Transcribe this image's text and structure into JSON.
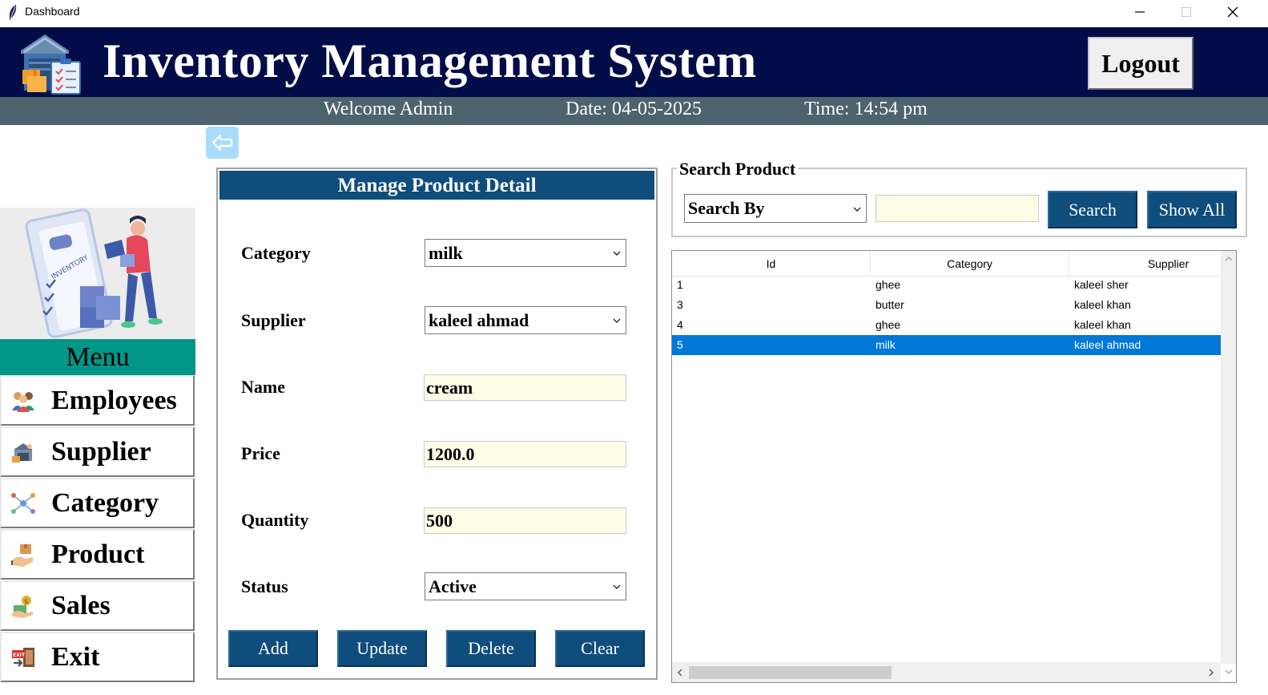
{
  "window": {
    "title": "Dashboard",
    "controls": [
      "minimize-icon",
      "maximize-icon",
      "close-icon"
    ]
  },
  "header": {
    "title": "Inventory Management System",
    "logout_label": "Logout",
    "colors": {
      "background": "#010c48",
      "subbar": "#4d636d"
    }
  },
  "subheader": {
    "welcome": "Welcome Admin",
    "date": "Date: 04-05-2025",
    "time": "Time: 14:54 pm"
  },
  "menu": {
    "heading": "Menu",
    "items": [
      {
        "label": "Employees",
        "icon": "employees-icon"
      },
      {
        "label": "Supplier",
        "icon": "supplier-icon"
      },
      {
        "label": "Category",
        "icon": "category-icon"
      },
      {
        "label": "Product",
        "icon": "product-icon"
      },
      {
        "label": "Sales",
        "icon": "sales-icon"
      },
      {
        "label": "Exit",
        "icon": "exit-icon"
      }
    ]
  },
  "manage": {
    "title": "Manage Product Detail",
    "fields": {
      "category": {
        "label": "Category",
        "value": "milk"
      },
      "supplier": {
        "label": "Supplier",
        "value": "kaleel ahmad"
      },
      "name": {
        "label": "Name",
        "value": "cream"
      },
      "price": {
        "label": "Price",
        "value": "1200.0"
      },
      "quantity": {
        "label": "Quantity",
        "value": "500"
      },
      "status": {
        "label": "Status",
        "value": "Active"
      }
    },
    "buttons": {
      "add": "Add",
      "update": "Update",
      "delete": "Delete",
      "clear": "Clear"
    },
    "accent": "#0f4d7d"
  },
  "search": {
    "legend": "Search Product",
    "search_by": "Search By",
    "query": "",
    "search_label": "Search",
    "show_all_label": "Show All"
  },
  "table": {
    "columns": [
      "Id",
      "Category",
      "Supplier"
    ],
    "rows": [
      {
        "id": "1",
        "category": "ghee",
        "supplier": "kaleel sher",
        "selected": false
      },
      {
        "id": "3",
        "category": "butter",
        "supplier": "kaleel khan",
        "selected": false
      },
      {
        "id": "4",
        "category": "ghee",
        "supplier": "kaleel khan",
        "selected": false
      },
      {
        "id": "5",
        "category": "milk",
        "supplier": "kaleel ahmad",
        "selected": true
      }
    ],
    "selection_color": "#0078d7"
  }
}
